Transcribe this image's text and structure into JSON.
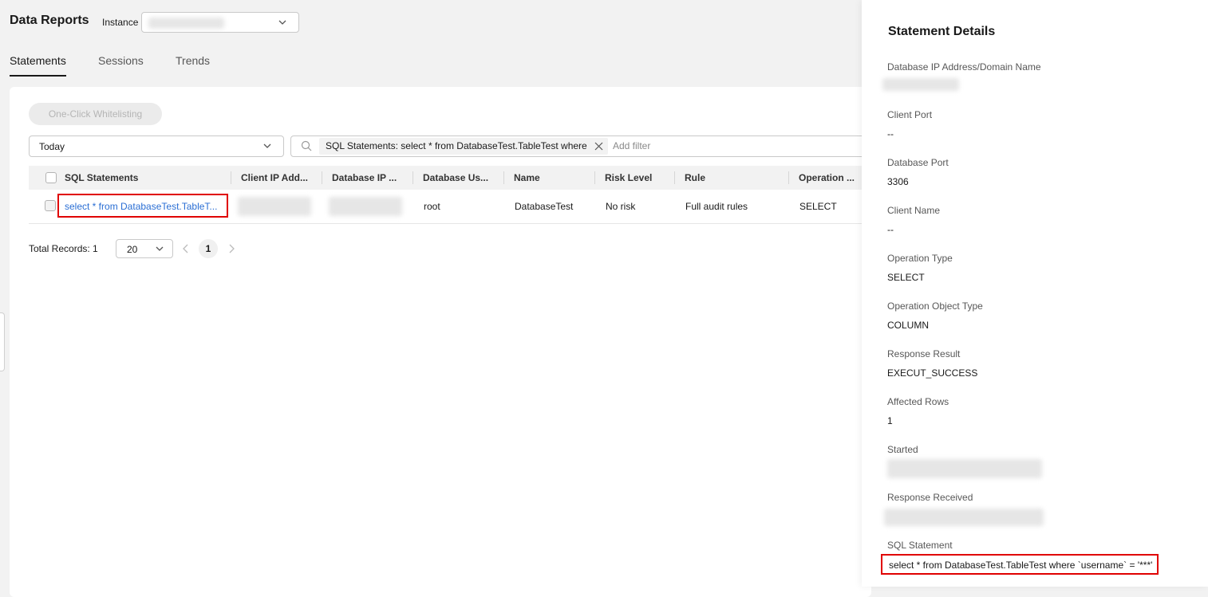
{
  "header": {
    "title": "Data Reports",
    "instance_label": "Instance"
  },
  "tabs": [
    {
      "label": "Statements",
      "active": true
    },
    {
      "label": "Sessions",
      "active": false
    },
    {
      "label": "Trends",
      "active": false
    }
  ],
  "toolbar": {
    "whitelist_label": "One-Click Whitelisting"
  },
  "time_filter": {
    "value": "Today"
  },
  "search": {
    "tag_text": "SQL Statements: select * from DatabaseTest.TableTest where",
    "add_filter_placeholder": "Add filter"
  },
  "table": {
    "columns": [
      "SQL Statements",
      "Client IP Add...",
      "Database IP ...",
      "Database Us...",
      "Name",
      "Risk Level",
      "Rule",
      "Operation ..."
    ],
    "rows": [
      {
        "sql": "select * from DatabaseTest.TableT...",
        "db_user": "root",
        "name": "DatabaseTest",
        "risk_level": "No risk",
        "rule": "Full audit rules",
        "operation": "SELECT"
      }
    ]
  },
  "pagination": {
    "total_text": "Total Records: 1",
    "page_size": "20",
    "current_page": "1"
  },
  "drawer": {
    "title": "Statement Details",
    "fields": [
      {
        "label": "Database IP Address/Domain Name",
        "value": ""
      },
      {
        "label": "Client Port",
        "value": "--"
      },
      {
        "label": "Database Port",
        "value": "3306"
      },
      {
        "label": "Client Name",
        "value": "--"
      },
      {
        "label": "Operation Type",
        "value": "SELECT"
      },
      {
        "label": "Operation Object Type",
        "value": "COLUMN"
      },
      {
        "label": "Response Result",
        "value": "EXECUT_SUCCESS"
      },
      {
        "label": "Affected Rows",
        "value": "1"
      },
      {
        "label": "Started",
        "value": ""
      },
      {
        "label": "Response Received",
        "value": ""
      },
      {
        "label": "SQL Statement",
        "value": "select * from DatabaseTest.TableTest where `username` = '***'"
      }
    ]
  },
  "colors": {
    "link": "#2a6ed4",
    "highlight": "#e00000",
    "background": "#f2f2f2"
  },
  "icons": [
    "chevron-down-icon",
    "search-icon",
    "close-icon",
    "chevron-left-icon",
    "chevron-right-icon"
  ]
}
